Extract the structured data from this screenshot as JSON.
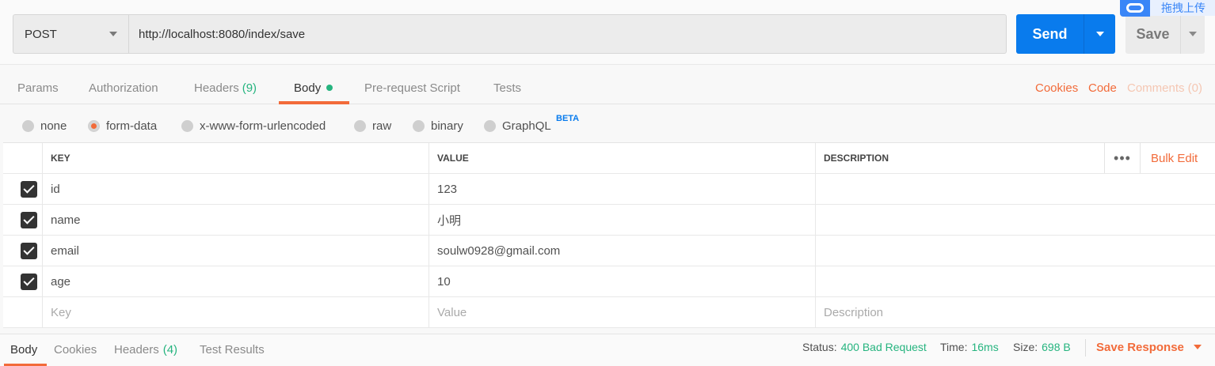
{
  "request": {
    "method": "POST",
    "url": "http://localhost:8080/index/save",
    "send_label": "Send",
    "save_label": "Save"
  },
  "upload_widget": {
    "text": "拖拽上传",
    "icon": "cloud-icon"
  },
  "tabs": [
    {
      "label": "Params"
    },
    {
      "label": "Authorization"
    },
    {
      "label": "Headers",
      "count": "(9)"
    },
    {
      "label": "Body",
      "active": true
    },
    {
      "label": "Pre-request Script"
    },
    {
      "label": "Tests"
    }
  ],
  "right_links": {
    "cookies": "Cookies",
    "code": "Code",
    "comments": "Comments (0)"
  },
  "body_types": {
    "options": [
      "none",
      "form-data",
      "x-www-form-urlencoded",
      "raw",
      "binary",
      "GraphQL"
    ],
    "selected": "form-data",
    "beta": "BETA"
  },
  "table": {
    "headers": {
      "key": "KEY",
      "value": "VALUE",
      "description": "DESCRIPTION"
    },
    "bulk_edit": "Bulk Edit",
    "more": "•••",
    "rows": [
      {
        "key": "id",
        "value": "123",
        "checked": true
      },
      {
        "key": "name",
        "value": "小明",
        "checked": true
      },
      {
        "key": "email",
        "value": "soulw0928@gmail.com",
        "checked": true
      },
      {
        "key": "age",
        "value": "10",
        "checked": true
      }
    ],
    "placeholders": {
      "key": "Key",
      "value": "Value",
      "description": "Description"
    }
  },
  "response": {
    "tabs": [
      {
        "label": "Body",
        "active": true
      },
      {
        "label": "Cookies"
      },
      {
        "label": "Headers",
        "count": "(4)"
      },
      {
        "label": "Test Results"
      }
    ],
    "status_label": "Status:",
    "status": "400 Bad Request",
    "time_label": "Time:",
    "time": "16ms",
    "size_label": "Size:",
    "size": "698 B",
    "save_response": "Save Response"
  },
  "colors": {
    "accent": "#f26b3a",
    "primary": "#097bed",
    "success": "#26b47f"
  }
}
